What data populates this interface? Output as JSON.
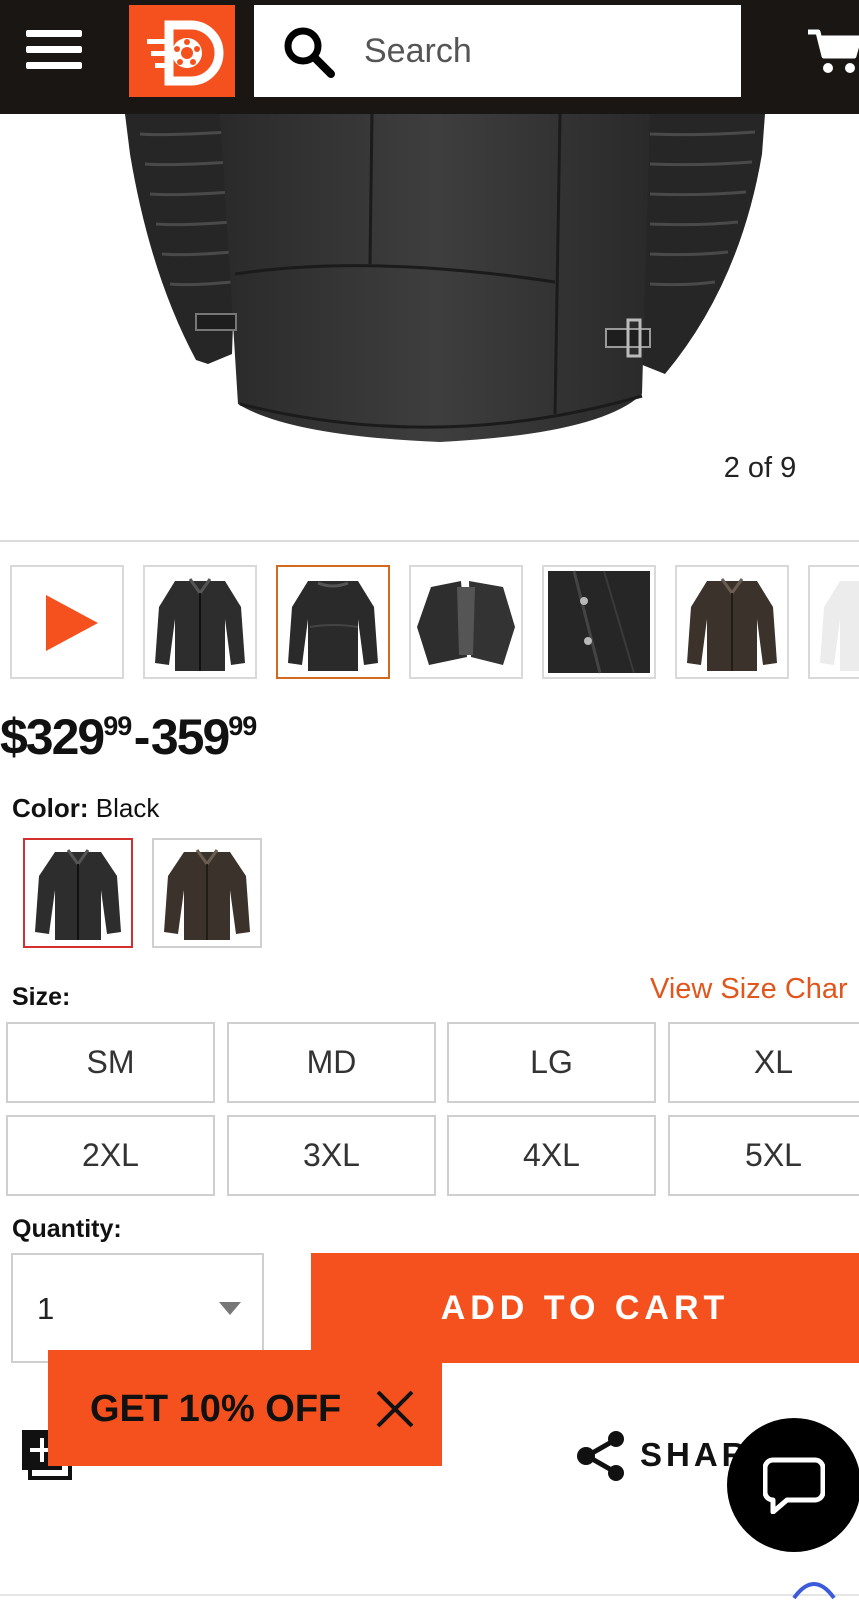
{
  "header": {
    "menu_icon": "hamburger-menu-icon",
    "logo_icon": "wheel-logo-icon",
    "search": {
      "placeholder": "Search",
      "icon": "search-icon"
    },
    "cart_icon": "cart-icon",
    "bar_color": "#1a1614",
    "accent_color": "#f4511e"
  },
  "gallery": {
    "counter": "2 of 9",
    "thumbnails": [
      {
        "kind": "video",
        "icon": "play-icon"
      },
      {
        "kind": "image",
        "label": "jacket-front"
      },
      {
        "kind": "image",
        "label": "jacket-back",
        "selected": true
      },
      {
        "kind": "image",
        "label": "jacket-open"
      },
      {
        "kind": "image",
        "label": "jacket-detail"
      },
      {
        "kind": "image",
        "label": "jacket-brown-front"
      },
      {
        "kind": "image",
        "label": "jacket-white"
      }
    ]
  },
  "price": {
    "low_dollars": "$329",
    "low_cents": "99",
    "separator": "-",
    "high_dollars": "359",
    "high_cents": "99"
  },
  "color": {
    "label": "Color:",
    "selected": "Black",
    "swatches": [
      {
        "name": "Black",
        "selected": true
      },
      {
        "name": "Brown",
        "selected": false
      }
    ],
    "selected_border_color": "#d32f2f"
  },
  "size": {
    "label": "Size:",
    "chart_link": "View Size Char",
    "options": [
      "SM",
      "MD",
      "LG",
      "XL",
      "2XL",
      "3XL",
      "4XL",
      "5XL"
    ]
  },
  "quantity": {
    "label": "Quantity:",
    "value": "1"
  },
  "actions": {
    "add_to_cart": "ADD TO CART",
    "wishlist": "ADD TO WISH LIST",
    "share": "SHAR"
  },
  "promo": {
    "text": "GET 10% OFF",
    "close_icon": "close-icon"
  },
  "chat": {
    "icon": "chat-bubble-icon"
  }
}
